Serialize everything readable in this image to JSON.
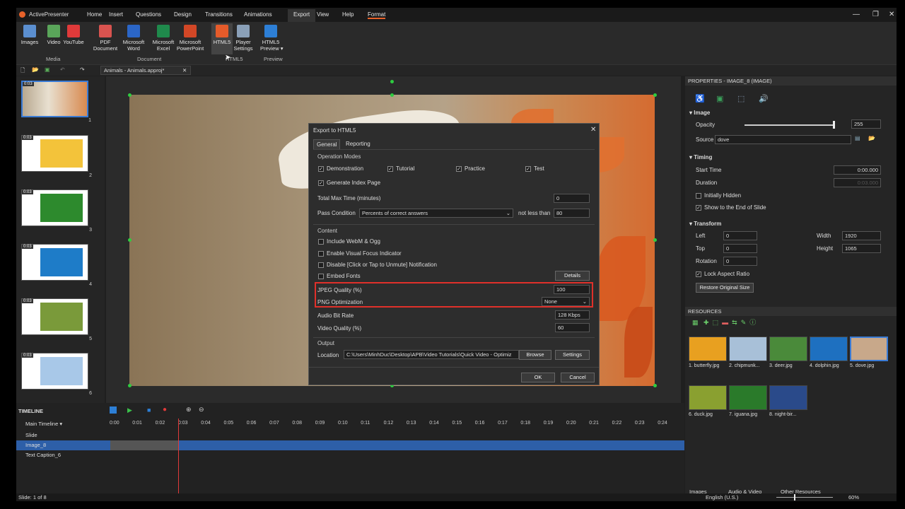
{
  "app": {
    "name": "ActivePresenter"
  },
  "menu": [
    "Home",
    "Insert",
    "Questions",
    "Design",
    "Transitions",
    "Animations",
    "Export",
    "View",
    "Help",
    "Format"
  ],
  "ribbon": {
    "buttons": [
      {
        "label": "Images",
        "icon": "images-icon",
        "color": "#5b8fd0"
      },
      {
        "label": "Video",
        "icon": "video-icon",
        "color": "#5aa55a"
      },
      {
        "label": "YouTube",
        "icon": "youtube-icon",
        "color": "#e03a3a"
      },
      {
        "label": "PDF\nDocument",
        "icon": "pdf-icon",
        "color": "#d9534f"
      },
      {
        "label": "Microsoft\nWord",
        "icon": "word-icon",
        "color": "#2b66c7"
      },
      {
        "label": "Microsoft\nExcel",
        "icon": "excel-icon",
        "color": "#1f8a4c"
      },
      {
        "label": "Microsoft\nPowerPoint",
        "icon": "powerpoint-icon",
        "color": "#d24726"
      },
      {
        "label": "HTML5",
        "icon": "html5-icon",
        "color": "#e55b2a"
      },
      {
        "label": "Player\nSettings",
        "icon": "gear-icon",
        "color": "#8aa0b8"
      },
      {
        "label": "HTML5\nPreview ▾",
        "icon": "play-preview-icon",
        "color": "#2d7fd6"
      }
    ],
    "groups": [
      "Media",
      "Document",
      "HTML5",
      "Preview"
    ]
  },
  "document_tab": "Animals - Animals.approj*",
  "slides": [
    {
      "time": "0:03",
      "num": "1",
      "bg": "#c9b8a0"
    },
    {
      "time": "0:03",
      "num": "2",
      "bg": "#f3c33a"
    },
    {
      "time": "0:03",
      "num": "3",
      "bg": "#2d8a2d"
    },
    {
      "time": "0:03",
      "num": "4",
      "bg": "#1e7cc8"
    },
    {
      "time": "0:03",
      "num": "5",
      "bg": "#7a9a3a"
    },
    {
      "time": "0:03",
      "num": "6",
      "bg": "#a8c8e8"
    }
  ],
  "dialog": {
    "title": "Export to HTML5",
    "tabs": [
      "General",
      "Reporting"
    ],
    "operation_modes_label": "Operation Modes",
    "modes": [
      "Demonstration",
      "Tutorial",
      "Practice",
      "Test"
    ],
    "generate_index": "Generate Index Page",
    "total_max_time_label": "Total Max Time (minutes)",
    "total_max_time": "0",
    "pass_condition_label": "Pass Condition",
    "pass_condition": "Percents of correct answers",
    "not_less_than": "not less than",
    "pass_value": "80",
    "content_label": "Content",
    "content_options": [
      "Include WebM & Ogg",
      "Enable Visual Focus Indicator",
      "Disable [Click or Tap to Unmute] Notification",
      "Embed Fonts"
    ],
    "details": "Details",
    "jpeg_label": "JPEG Quality (%)",
    "jpeg_value": "100",
    "png_label": "PNG Optimization",
    "png_value": "None",
    "audio_label": "Audio Bit Rate",
    "audio_value": "128 Kbps",
    "video_label": "Video Quality (%)",
    "video_value": "60",
    "output_label": "Output",
    "location_label": "Location",
    "location_value": "C:\\Users\\MinhDuc\\Desktop\\APB\\Video Tutorials\\Quick Video - Optimiz",
    "browse": "Browse",
    "settings": "Settings",
    "ok": "OK",
    "cancel": "Cancel",
    "highlight_color": "#e0302a"
  },
  "properties": {
    "header": "PROPERTIES - IMAGE_8 (IMAGE)",
    "image_section": "Image",
    "opacity_label": "Opacity",
    "opacity_value": "255",
    "source_label": "Source",
    "source_value": "dove",
    "timing_section": "Timing",
    "start_time_label": "Start Time",
    "start_time": "0:00.000",
    "duration_label": "Duration",
    "duration": "0:03.000",
    "initially_hidden": "Initially Hidden",
    "show_to_end": "Show to the End of Slide",
    "transform_section": "Transform",
    "left_label": "Left",
    "left": "0",
    "top_label": "Top",
    "top": "0",
    "rotation_label": "Rotation",
    "rotation": "0",
    "width_label": "Width",
    "width": "1920",
    "height_label": "Height",
    "height": "1065",
    "lock_aspect": "Lock Aspect Ratio",
    "restore": "Restore Original Size"
  },
  "resources": {
    "header": "RESOURCES",
    "items": [
      {
        "name": "1. butterfly.jpg",
        "bg": "#e8a020"
      },
      {
        "name": "2. chipmunk...",
        "bg": "#a8c0d8"
      },
      {
        "name": "3. deer.jpg",
        "bg": "#4a8a3a"
      },
      {
        "name": "4. dolphin.jpg",
        "bg": "#1e70c0"
      },
      {
        "name": "5. dove.jpg",
        "bg": "#c8a88a"
      },
      {
        "name": "6. duck.jpg",
        "bg": "#8aa030"
      },
      {
        "name": "7. iguana.jpg",
        "bg": "#2a7a2a"
      },
      {
        "name": "8. night-bir...",
        "bg": "#2a4a8a"
      }
    ],
    "tabs": [
      "Images",
      "Audio & Video",
      "Other Resources"
    ]
  },
  "timeline": {
    "header": "TIMELINE",
    "main": "Main Timeline",
    "ticks": [
      "0:00",
      "0:01",
      "0:02",
      "0:03",
      "0:04",
      "0:05",
      "0:06",
      "0:07",
      "0:08",
      "0:09",
      "0:10",
      "0:11",
      "0:12",
      "0:13",
      "0:14",
      "0:15",
      "0:16",
      "0:17",
      "0:18",
      "0:19",
      "0:20",
      "0:21",
      "0:22",
      "0:23",
      "0:24"
    ],
    "rows": [
      "Slide",
      "Image_8",
      "Text Caption_6"
    ]
  },
  "status": {
    "slide": "Slide: 1 of 8",
    "language": "English (U.S.)",
    "zoom": "60%"
  }
}
